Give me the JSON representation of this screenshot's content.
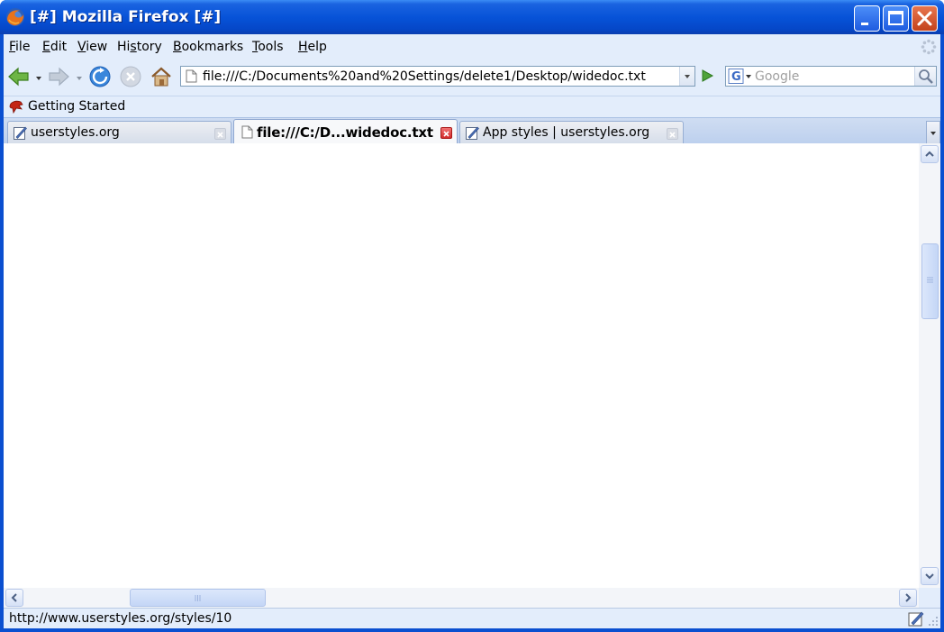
{
  "window": {
    "title": "[#] Mozilla Firefox [#]"
  },
  "menubar": {
    "items": [
      {
        "first": "F",
        "rest": "ile"
      },
      {
        "first": "E",
        "rest": "dit"
      },
      {
        "first": "V",
        "rest": "iew"
      },
      {
        "first": "",
        "rest": "History",
        "underline_index": 2
      },
      {
        "first": "B",
        "rest": "ookmarks"
      },
      {
        "first": "T",
        "rest": "ools"
      },
      {
        "first": "H",
        "rest": "elp"
      }
    ]
  },
  "navbar": {
    "url": "file:///C:/Documents%20and%20Settings/delete1/Desktop/widedoc.txt",
    "search_placeholder": "Google"
  },
  "bookmarks": {
    "items": [
      {
        "label": "Getting Started"
      }
    ]
  },
  "tabs": [
    {
      "label": "userstyles.org",
      "active": false
    },
    {
      "label": "file:///C:/D...widedoc.txt",
      "active": true
    },
    {
      "label": "App styles | userstyles.org",
      "active": false
    }
  ],
  "statusbar": {
    "text": "http://www.userstyles.org/styles/10"
  },
  "colors": {
    "titlebar": "#0753D8",
    "chrome": "#E3EDFB",
    "close_button": "#C3421C"
  }
}
